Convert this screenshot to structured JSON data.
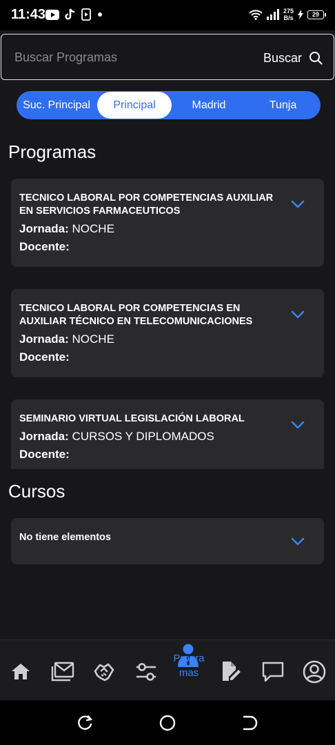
{
  "status_bar": {
    "time": "11:43",
    "net_speed_value": "275",
    "net_speed_unit": "B/s",
    "battery": "29"
  },
  "search": {
    "placeholder": "Buscar Programas",
    "value": "",
    "button_label": "Buscar"
  },
  "tabs": [
    {
      "label": "Suc. Principal",
      "active": false
    },
    {
      "label": "Principal",
      "active": true
    },
    {
      "label": "Madrid",
      "active": false
    },
    {
      "label": "Tunja",
      "active": false
    }
  ],
  "programs": {
    "title": "Programas",
    "items": [
      {
        "title_line1": "TECNICO LABORAL POR COMPETENCIAS AUXILIAR",
        "title_line2": "EN SERVICIOS FARMACEUTICOS",
        "jornada_label": "Jornada:",
        "jornada_value": "NOCHE",
        "docente_label": "Docente:",
        "docente_value": ""
      },
      {
        "title_line1": "TECNICO LABORAL POR COMPETENCIAS EN",
        "title_line2": "AUXILIAR TÉCNICO EN TELECOMUNICACIONES",
        "jornada_label": "Jornada:",
        "jornada_value": "NOCHE",
        "docente_label": "Docente:",
        "docente_value": ""
      },
      {
        "title_line1": "SEMINARIO VIRTUAL LEGISLACIÓN LABORAL",
        "title_line2": "",
        "jornada_label": "Jornada:",
        "jornada_value": "CURSOS Y DIPLOMADOS",
        "docente_label": "Docente:",
        "docente_value": ""
      }
    ]
  },
  "courses": {
    "title": "Cursos",
    "empty_text": "No tiene elementos"
  },
  "bottom_nav": {
    "items": [
      {
        "icon": "home-icon"
      },
      {
        "icon": "mail-icon"
      },
      {
        "icon": "handshake-icon"
      },
      {
        "icon": "sliders-icon"
      },
      {
        "icon": "teacher-icon",
        "label": "Programas",
        "label_line1": "Progra",
        "label_line2": "mas",
        "active": true
      },
      {
        "icon": "edit-document-icon"
      },
      {
        "icon": "chat-icon"
      },
      {
        "icon": "user-icon"
      }
    ]
  },
  "colors": {
    "background": "#171719",
    "card": "#2a2a2d",
    "accent": "#2f6ef0",
    "chevron": "#3b82f6"
  }
}
